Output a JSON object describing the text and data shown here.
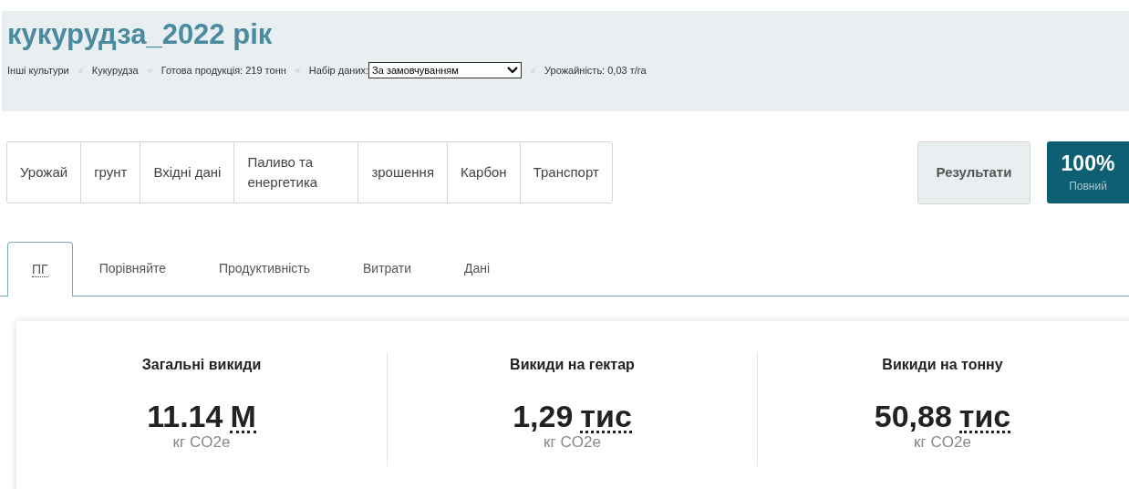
{
  "header": {
    "title": "кукурудза_2022 рік",
    "meta": [
      {
        "kind": "text",
        "text": "Інші культури"
      },
      {
        "kind": "text",
        "text": "Кукурудза"
      },
      {
        "kind": "text",
        "text": "Готова продукція: 219 тонн"
      },
      {
        "kind": "select",
        "label": "Набір даних:",
        "value": "За замовчуванням"
      },
      {
        "kind": "text",
        "text": "Урожайність: 0,03 т/га"
      }
    ]
  },
  "nav": [
    "Урожай",
    "грунт",
    "Вхідні дані",
    "Паливо та енергетика",
    "зрошення",
    "Карбон",
    "Транспорт"
  ],
  "results_button": "Результати",
  "completion": {
    "percent": "100%",
    "label": "Повний"
  },
  "tabs": [
    {
      "label": "ПГ",
      "selected": true,
      "abbr": true
    },
    {
      "label": "Порівняйте",
      "selected": false,
      "abbr": false
    },
    {
      "label": "Продуктивність",
      "selected": false,
      "abbr": false
    },
    {
      "label": "Витрати",
      "selected": false,
      "abbr": false
    },
    {
      "label": "Дані",
      "selected": false,
      "abbr": false
    }
  ],
  "metrics": [
    {
      "title": "Загальні викиди",
      "value": "11.14",
      "unit": "М",
      "caption": "кг CO2e"
    },
    {
      "title": "Викиди на гектар",
      "value": "1,29",
      "unit": "тис",
      "caption": "кг CO2e"
    },
    {
      "title": "Викиди на тонну",
      "value": "50,88",
      "unit": "тис",
      "caption": "кг CO2e"
    }
  ]
}
